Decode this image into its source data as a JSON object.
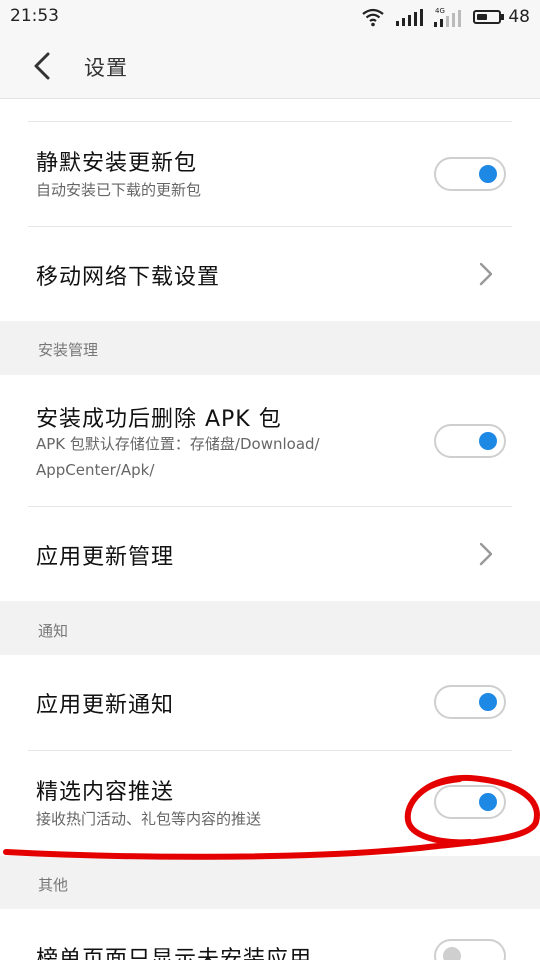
{
  "status_bar": {
    "time": "21:53",
    "battery": "48",
    "battery_level": 0.48,
    "network_label": "4G"
  },
  "header": {
    "title": "设置"
  },
  "rows": {
    "silent_install": {
      "title": "静默安装更新包",
      "subtitle": "自动安装已下载的更新包",
      "toggle_on": true
    },
    "mobile_download": {
      "title": "移动网络下载设置"
    },
    "delete_apk": {
      "title": "安装成功后删除 APK 包",
      "subtitle_line1": "APK 包默认存储位置：存储盘/Download/",
      "subtitle_line2": "AppCenter/Apk/",
      "toggle_on": true
    },
    "app_update_mgmt": {
      "title": "应用更新管理"
    },
    "update_notify": {
      "title": "应用更新通知",
      "toggle_on": true
    },
    "featured_push": {
      "title": "精选内容推送",
      "subtitle": "接收热门活动、礼包等内容的推送",
      "toggle_on": true
    },
    "uninstalled_only": {
      "title": "榜单页面只显示未安装应用",
      "toggle_on": false
    }
  },
  "sections": {
    "install_mgmt": "安装管理",
    "notification": "通知",
    "other": "其他"
  },
  "colors": {
    "accent": "#1e88e5",
    "annotation": "#e50000"
  }
}
